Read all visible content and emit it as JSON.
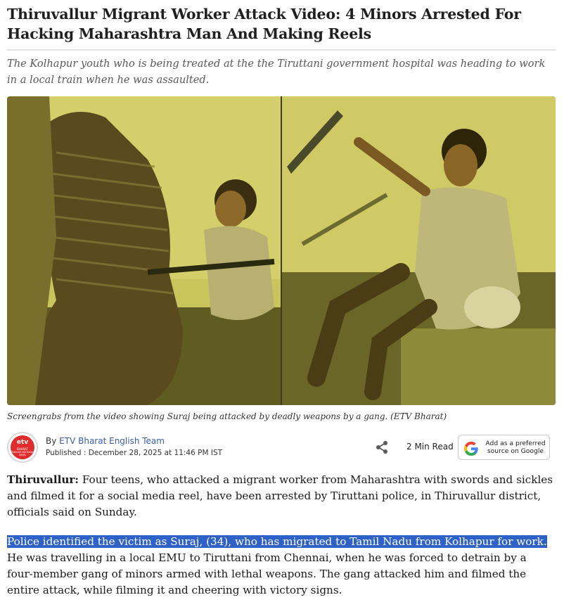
{
  "article": {
    "headline": "Thiruvallur Migrant Worker Attack Video: 4 Minors Arrested For Hacking Maharashtra Man And Making Reels",
    "subhead": "The Kolhapur youth who is being treated at the the Tiruttani government hospital was heading to work in a local train when he was assaulted.",
    "image_caption": "Screengrabs from the video showing Suraj being attacked by deadly weapons by a gang. (ETV Bharat)"
  },
  "byline": {
    "logo_text": "etv",
    "logo_sub1": "BHARAT",
    "logo_sub2": "ENGLISH NATIONAL NEWS",
    "by_prefix": "By",
    "author": "ETV Bharat English Team",
    "published": "Published : December 28, 2025 at 11:46 PM IST",
    "share_icon": "share-icon",
    "read_time": "2 Min Read",
    "google_button": "Add as a preferred source on Google"
  },
  "body": {
    "p1_lead": "Thiruvallur:",
    "p1_text": " Four teens, who attacked a migrant worker from Maharashtra with swords and sickles and filmed it for a social media reel, have been arrested by Tiruttani police, in Thiruvallur district, officials said on Sunday.",
    "p2_highlighted": "Police identified the victim as Suraj, (34), who has migrated to Tamil Nadu from Kolhapur for work.",
    "p2_text": " He was travelling in a local EMU to Tiruttani from Chennai, when he was forced to detrain by a four-member gang of minors armed with lethal weapons. The gang attacked him and filmed the entire attack, while filming it and cheering with victory signs."
  },
  "colors": {
    "link": "#3a5fb0",
    "highlight": "#2e62c8",
    "image_tint": "#b4b04a",
    "logo_red": "#e12c2c"
  }
}
